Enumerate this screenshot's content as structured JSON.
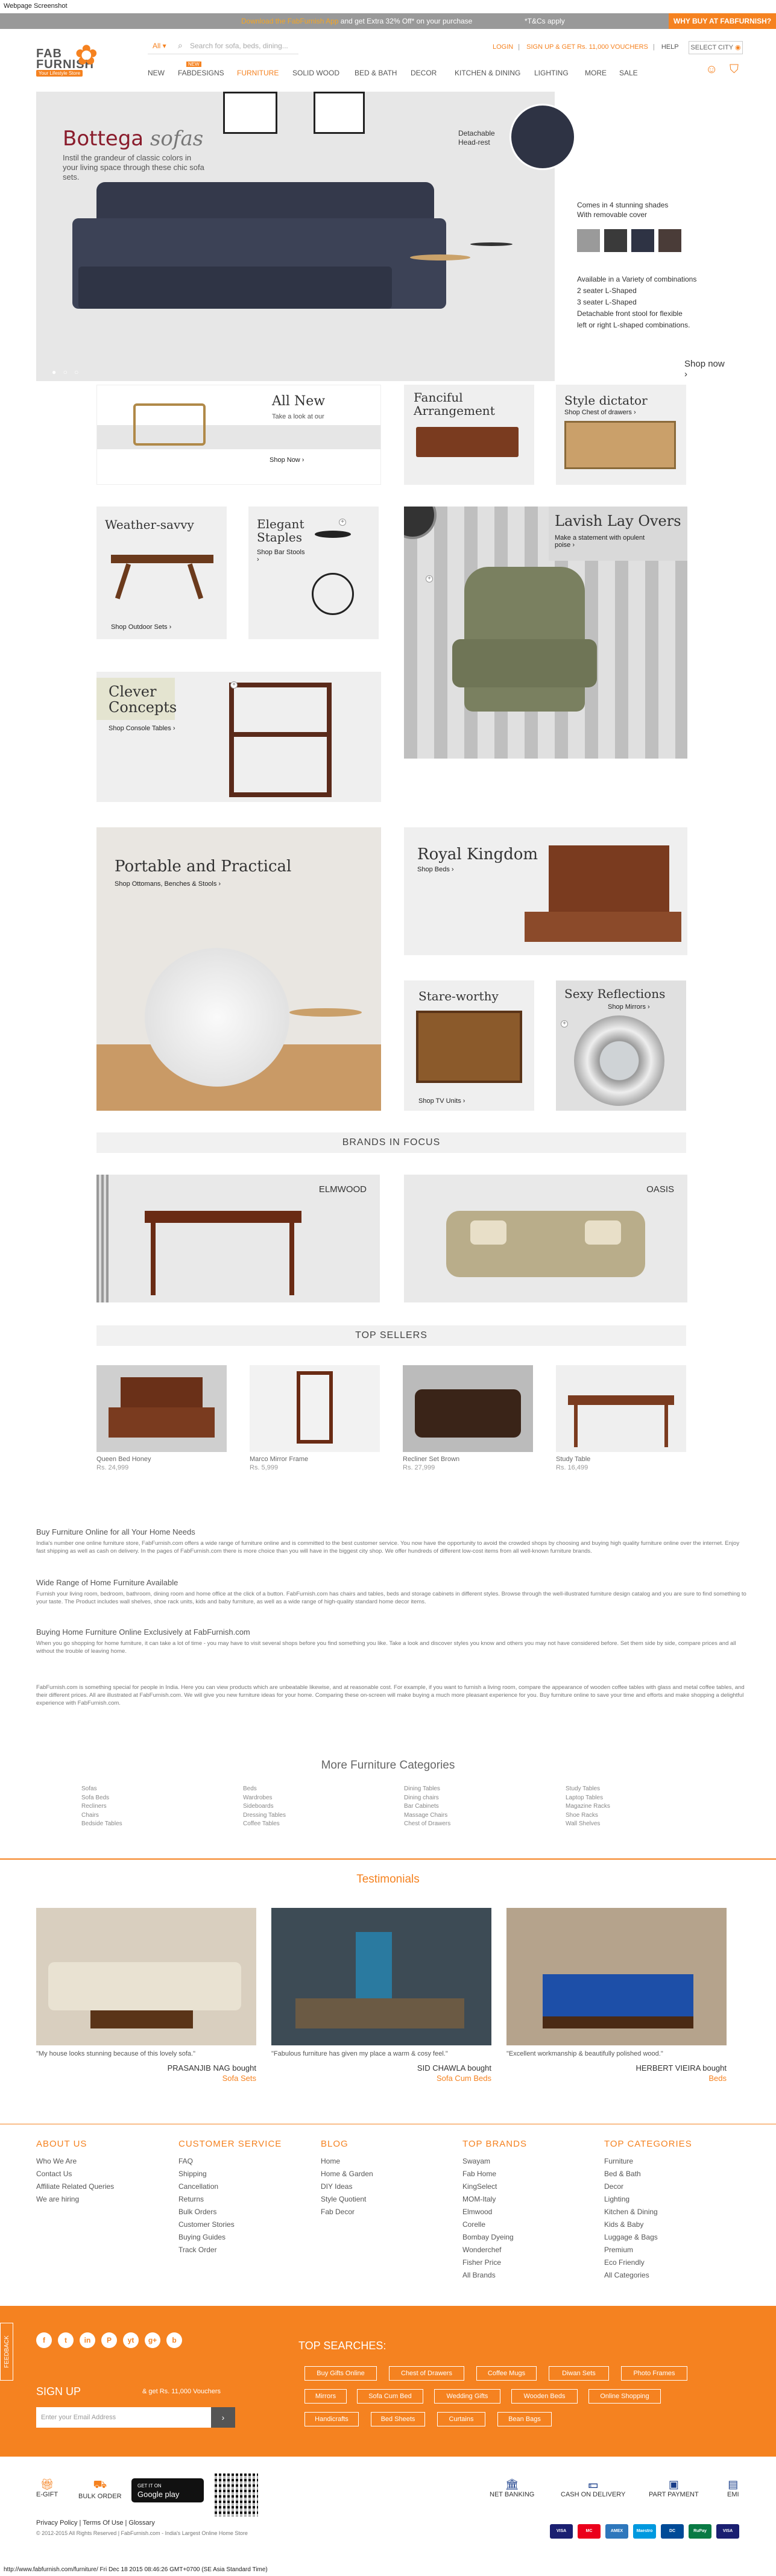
{
  "screenshot_caption": "Webpage Screenshot",
  "footer_caption": "http://www.fabfurnish.com/furniture/ Fri Dec 18 2015 08:46:26 GMT+0700 (SE Asia Standard Time)",
  "promo": {
    "text_a": "Download the FabFurnish App",
    "text_b": "and get Extra 32% Off* on your purchase",
    "tnc": "*T&Cs apply",
    "buy": "WHY BUY AT FABFURNISH?"
  },
  "logo": {
    "line1": "FAB",
    "line2": "FURNISH",
    "tag": "Your Lifestyle Store"
  },
  "search": {
    "scope": "All",
    "placeholder": "Search for sofa, beds, dining..."
  },
  "toplinks": {
    "login": "LOGIN",
    "signup": "SIGN UP & GET Rs. 11,000 VOUCHERS",
    "help": "HELP"
  },
  "city": "SELECT CITY",
  "nav": {
    "items": [
      "NEW",
      "FABDESIGNS",
      "FURNITURE",
      "SOLID WOOD",
      "BED & BATH",
      "DECOR",
      "KITCHEN & DINING",
      "LIGHTING",
      "MORE",
      "SALE"
    ],
    "badge": "NEW"
  },
  "hero": {
    "title_a": "Bottega",
    "title_b": "sofas",
    "sub": "Instil the grandeur of classic colors in your living space through these chic sofa sets.",
    "detach": "Detachable Head-rest",
    "comes_a": "Comes in 4 stunning shades",
    "comes_b": "With removable cover",
    "avail_title": "Available in a Variety of combinations",
    "avail_items": [
      "2 seater L-Shaped",
      "3 seater L-Shaped",
      "Detachable front stool for flexible",
      "left or right L-shaped combinations."
    ],
    "shop": "Shop now ›",
    "swatches": [
      "#9a9a9a",
      "#3a3a3a",
      "#2e3344",
      "#4a3c38"
    ]
  },
  "tiles": {
    "allnew": {
      "t": "All New",
      "s": "Take a look at our",
      "c": "Shop Now ›"
    },
    "fanciful": {
      "t": "Fanciful Arrangement"
    },
    "style": {
      "t": "Style dictator",
      "s": "Shop Chest of drawers ›"
    },
    "weather": {
      "t": "Weather-savvy",
      "c": "Shop Outdoor Sets ›"
    },
    "elegant": {
      "t": "Elegant Staples",
      "c": "Shop Bar Stools ›"
    },
    "lavish": {
      "t": "Lavish Lay Overs",
      "s": "Make a statement with opulent poise ›"
    },
    "clever": {
      "t": "Clever Concepts",
      "c": "Shop Console Tables ›"
    },
    "portable": {
      "t": "Portable and Practical",
      "c": "Shop Ottomans, Benches & Stools ›"
    },
    "royal": {
      "t": "Royal Kingdom",
      "c": "Shop Beds ›"
    },
    "stare": {
      "t": "Stare-worthy",
      "c": "Shop TV Units ›"
    },
    "sexy": {
      "t": "Sexy Reflections",
      "c": "Shop Mirrors ›"
    }
  },
  "brands": {
    "title": "BRANDS IN FOCUS",
    "items": [
      "ELMWOOD",
      "OASIS"
    ]
  },
  "sellers": {
    "title": "TOP SELLERS",
    "items": [
      {
        "name": "Queen Bed Honey",
        "price": "Rs. 24,999"
      },
      {
        "name": "Marco Mirror Frame",
        "price": "Rs. 5,999"
      },
      {
        "name": "Recliner Set Brown",
        "price": "Rs. 27,999"
      },
      {
        "name": "Study Table",
        "price": "Rs. 16,499"
      }
    ]
  },
  "seo": {
    "h1": "Buy Furniture Online for all Your Home Needs",
    "p1": "India's number one online furniture store, FabFurnish.com offers a wide range of furniture online and is committed to the best customer service. You now have the opportunity to avoid the crowded shops by choosing and buying high quality furniture online over the internet. Enjoy fast shipping as well as cash on delivery. In the pages of FabFurnish.com there is more choice than you will have in the biggest city shop. We offer hundreds of different low-cost items from all well-known furniture brands.",
    "h2": "Wide Range of Home Furniture Available",
    "p2": "Furnish your living room, bedroom, bathroom, dining room and home office at the click of a button. FabFurnish.com has chairs and tables, beds and storage cabinets in different styles. Browse through the well-illustrated furniture design catalog and you are sure to find something to your taste. The Product includes wall shelves, shoe rack units, kids and baby furniture, as well as a wide range of high-quality standard home decor items.",
    "h3": "Buying Home Furniture Online Exclusively at FabFurnish.com",
    "p3": "When you go shopping for home furniture, it can take a lot of time - you may have to visit several shops before you find something you like. Take a look and discover styles you know and others you may not have considered before. Set them side by side, compare prices and all without the trouble of leaving home.",
    "p4": "FabFurnish.com is something special for people in India. Here you can view products which are unbeatable likewise, and at reasonable cost. For example, if you want to furnish a living room, compare the appearance of wooden coffee tables with glass and metal coffee tables, and their different prices. All are illustrated at FabFurnish.com. We will give you new furniture ideas for your home. Comparing these on-screen will make buying a much more pleasant experience for you. Buy furniture online to save your time and efforts and make shopping a delightful experience with FabFurnish.com."
  },
  "morecat": {
    "title": "More Furniture Categories",
    "cols": [
      [
        "Sofas",
        "Sofa Beds",
        "Recliners",
        "Chairs",
        "Bedside Tables"
      ],
      [
        "Beds",
        "Wardrobes",
        "Sideboards",
        "Dressing Tables",
        "Coffee Tables"
      ],
      [
        "Dining Tables",
        "Dining chairs",
        "Bar Cabinets",
        "Massage Chairs",
        "Chest of Drawers"
      ],
      [
        "Study Tables",
        "Laptop Tables",
        "Magazine Racks",
        "Shoe Racks",
        "Wall Shelves"
      ]
    ]
  },
  "testimonials": {
    "title": "Testimonials",
    "items": [
      {
        "q": "\"My house looks stunning because of this lovely sofa.\"",
        "by": "PRASANJIB NAG bought",
        "p": "Sofa Sets"
      },
      {
        "q": "\"Fabulous furniture has given my place a warm & cosy feel.\"",
        "by": "SID CHAWLA bought",
        "p": "Sofa Cum Beds"
      },
      {
        "q": "\"Excellent workmanship & beautifully polished wood.\"",
        "by": "HERBERT VIEIRA bought",
        "p": "Beds"
      }
    ]
  },
  "footlinks": [
    {
      "h": "ABOUT US",
      "items": [
        "Who We Are",
        "Contact Us",
        "Affiliate Related Queries",
        "We are hiring"
      ]
    },
    {
      "h": "CUSTOMER SERVICE",
      "items": [
        "FAQ",
        "Shipping",
        "Cancellation",
        "Returns",
        "Bulk Orders",
        "Customer Stories",
        "Buying Guides",
        "Track Order"
      ]
    },
    {
      "h": "BLOG",
      "items": [
        "Home",
        "Home & Garden",
        "DIY Ideas",
        "Style Quotient",
        "Fab Decor"
      ]
    },
    {
      "h": "TOP BRANDS",
      "items": [
        "Swayam",
        "Fab Home",
        "KingSelect",
        "MOM-Italy",
        "Elmwood",
        "Corelle",
        "Bombay Dyeing",
        "Wonderchef",
        "Fisher Price",
        "All Brands"
      ]
    },
    {
      "h": "TOP CATEGORIES",
      "items": [
        "Furniture",
        "Bed & Bath",
        "Decor",
        "Lighting",
        "Kitchen & Dining",
        "Kids & Baby",
        "Luggage & Bags",
        "Premium",
        "Eco Friendly",
        "All Categories"
      ]
    }
  ],
  "social": [
    "f",
    "t",
    "in",
    "P",
    "yt",
    "g+",
    "b"
  ],
  "signup": {
    "title": "SIGN UP",
    "offer": "& get Rs. 11,000 Vouchers",
    "placeholder": "Enter your Email Address",
    "go": "›"
  },
  "topsearches": {
    "title": "TOP SEARCHES:",
    "items": [
      "Buy Gifts Online",
      "Chest of Drawers",
      "Coffee Mugs",
      "Diwan Sets",
      "Photo Frames",
      "Mirrors",
      "Sofa Cum Bed",
      "Wedding Gifts",
      "Wooden Beds",
      "Online Shopping",
      "Handicrafts",
      "Bed Sheets",
      "Curtains",
      "Bean Bags"
    ]
  },
  "feedback": "FEEDBACK",
  "bottom": {
    "egift": "E-GIFT",
    "bulk": "BULK ORDER",
    "gp_a": "GET IT ON",
    "gp_b": "Google play",
    "pay": [
      "NET BANKING",
      "CASH ON DELIVERY",
      "PART PAYMENT",
      "EMI"
    ],
    "legal": "Privacy Policy | Terms Of Use | Glossary",
    "copy": "© 2012-2015 All Rights Reserved | FabFurnish.com - India's Largest Online Home Store",
    "cards": [
      "VISA",
      "MC",
      "AMEX",
      "Maestro",
      "DC",
      "RuPay",
      "VISA"
    ]
  },
  "colors": {
    "accent": "#f58220",
    "hero_title": "#8a1c2c",
    "wood": "#7a3b1f"
  }
}
